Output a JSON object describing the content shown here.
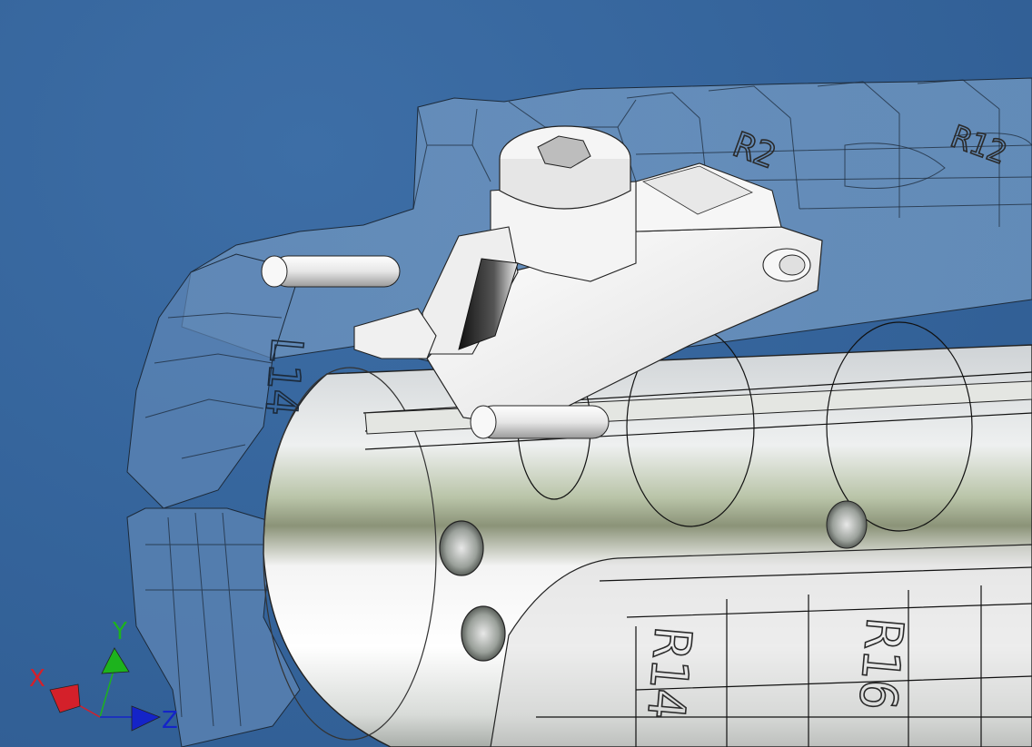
{
  "viewport": {
    "background": "#34639a"
  },
  "part_labels": {
    "r14": "R14",
    "r16": "R16",
    "r2": "R2",
    "l14": "L14",
    "r12": "R12"
  },
  "triad": {
    "x_label": "X",
    "y_label": "Y",
    "z_label": "Z",
    "x_color": "#d4202a",
    "y_color": "#1db31d",
    "z_color": "#1424c8"
  }
}
